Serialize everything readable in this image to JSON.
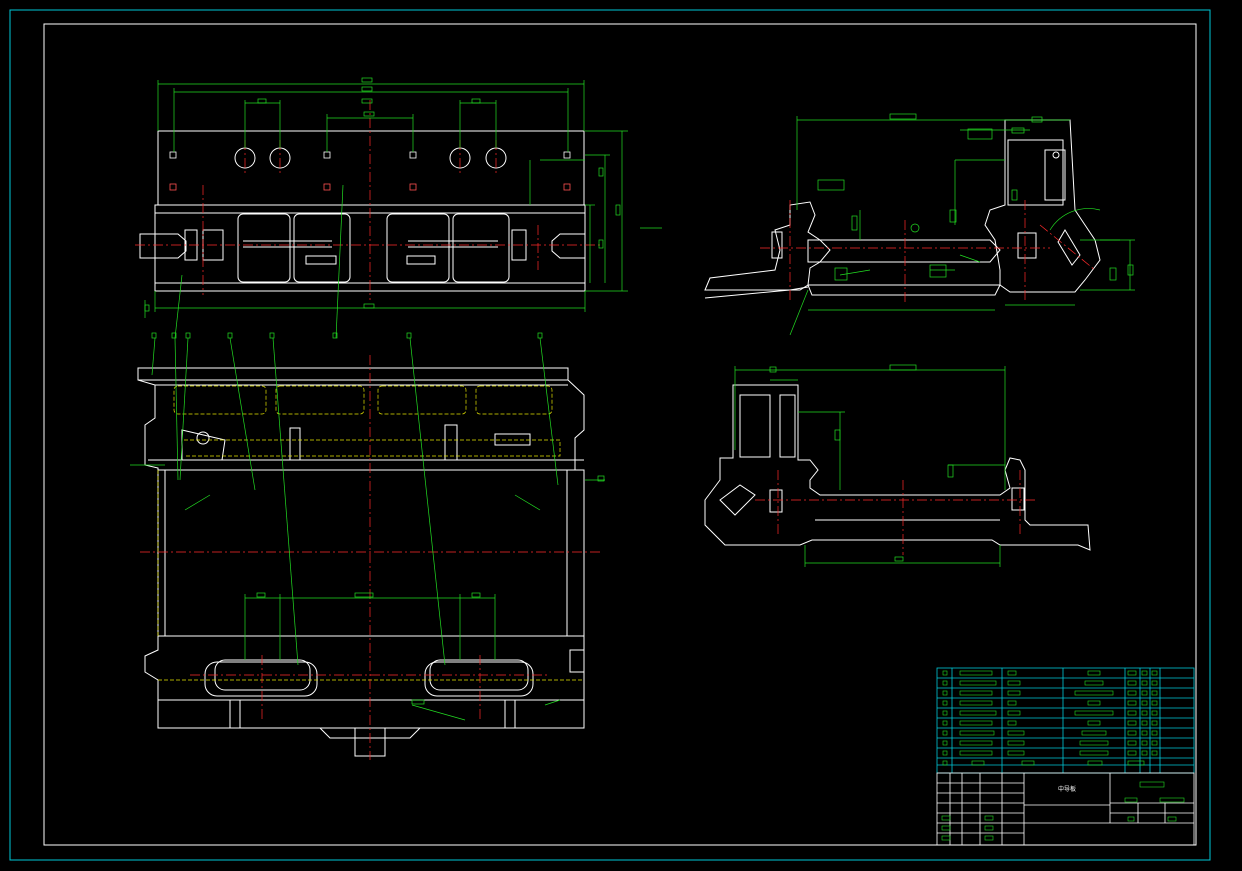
{
  "drawing": {
    "title_block": {
      "drawing_name": "中导板"
    },
    "parts_list_rows": 10,
    "colors": {
      "background": "#000000",
      "frame": "#ffffff",
      "outer_border": "#00c8d8",
      "dimension": "#22dd22",
      "centerline": "#ff2a2a",
      "hidden": "#e6e600",
      "table": "#00c8d8"
    }
  }
}
